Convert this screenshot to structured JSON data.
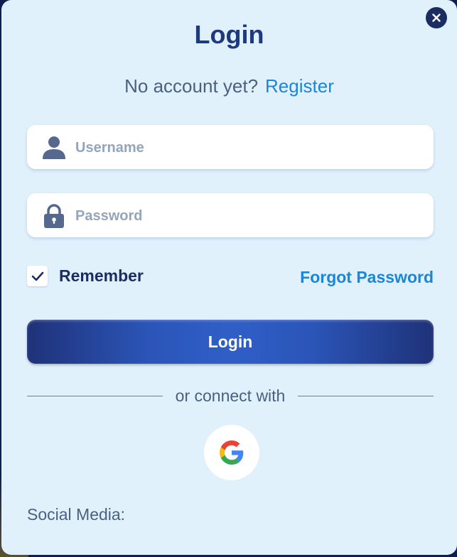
{
  "modal": {
    "title": "Login",
    "no_account_text": "No account yet?",
    "register_link": "Register",
    "close_icon": "close-icon"
  },
  "form": {
    "username": {
      "placeholder": "Username",
      "value": "",
      "icon": "user-icon"
    },
    "password": {
      "placeholder": "Password",
      "value": "",
      "icon": "lock-icon"
    },
    "remember": {
      "label": "Remember",
      "checked": true
    },
    "forgot_password": "Forgot Password",
    "submit_label": "Login"
  },
  "social": {
    "divider_text": "or connect with",
    "providers": [
      {
        "name": "Google",
        "icon": "google-icon"
      }
    ],
    "label": "Social Media:"
  },
  "colors": {
    "modal_bg": "#e1f1fc",
    "primary": "#1e3a7a",
    "link": "#1a86d8",
    "button_gradient_start": "#1f3278",
    "button_gradient_mid": "#2f5fc6"
  }
}
